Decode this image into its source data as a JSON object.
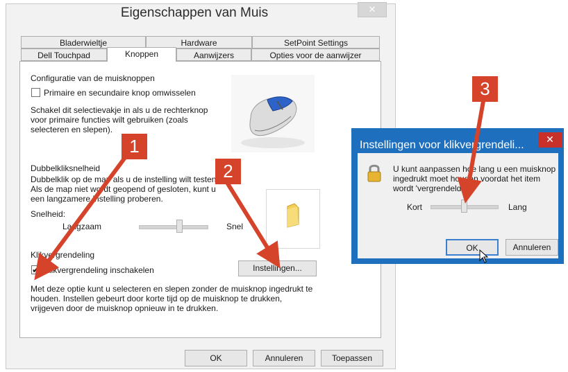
{
  "main_dialog": {
    "title": "Eigenschappen van Muis",
    "close": "✕",
    "tabs_row1": [
      "Bladerwieltje",
      "Hardware",
      "SetPoint Settings"
    ],
    "tabs_row2": [
      "Dell Touchpad",
      "Knoppen",
      "Aanwijzers",
      "Opties voor de aanwijzer"
    ],
    "active_tab": "Knoppen",
    "button_config": {
      "heading": "Configuratie van de muisknoppen",
      "swap_label": "Primaire en secundaire knop omwisselen",
      "swap_checked": false,
      "description_lines": [
        "Schakel dit selectievakje in als u de rechterknop",
        "voor primaire functies wilt gebruiken (zoals",
        "selecteren en slepen)."
      ]
    },
    "double_click": {
      "heading": "Dubbelkliksnelheid",
      "description_lines": [
        "Dubbelklik op de map als u de instelling wilt testen.",
        "Als de map niet wordt geopend of gesloten, kunt u",
        "een langzamere instelling proberen."
      ],
      "speed_label": "Snelheid:",
      "slow_label": "Langzaam",
      "fast_label": "Snel"
    },
    "click_lock": {
      "heading": "Klikvergrendeling",
      "enable_label": "Klikvergrendeling inschakelen",
      "enable_checked": true,
      "checkmark": "✔",
      "settings_button": "Instellingen...",
      "description_lines": [
        "Met deze optie kunt u selecteren en slepen zonder de muisknop ingedrukt te",
        "houden. Instellen gebeurt door korte tijd op de muisknop te drukken,",
        "vrijgeven door de muisknop opnieuw in te drukken."
      ]
    },
    "footer_buttons": {
      "ok": "OK",
      "cancel": "Annuleren",
      "apply": "Toepassen"
    }
  },
  "clicklock_dialog": {
    "title": "Instellingen voor klikvergrendeli...",
    "close": "✕",
    "message_lines": [
      "U kunt aanpassen hoe lang u een muisknop",
      "ingedrukt moet houden voordat het item",
      "wordt 'vergrendeld'."
    ],
    "short_label": "Kort",
    "long_label": "Lang",
    "ok": "OK",
    "cancel": "Annuleren"
  },
  "annotations": {
    "badge1": "1",
    "badge2": "2",
    "badge3": "3",
    "color": "#d5432a"
  },
  "icons": [
    "mouse-icon",
    "folder-icon",
    "lock-icon",
    "cursor-icon",
    "close-icon"
  ]
}
